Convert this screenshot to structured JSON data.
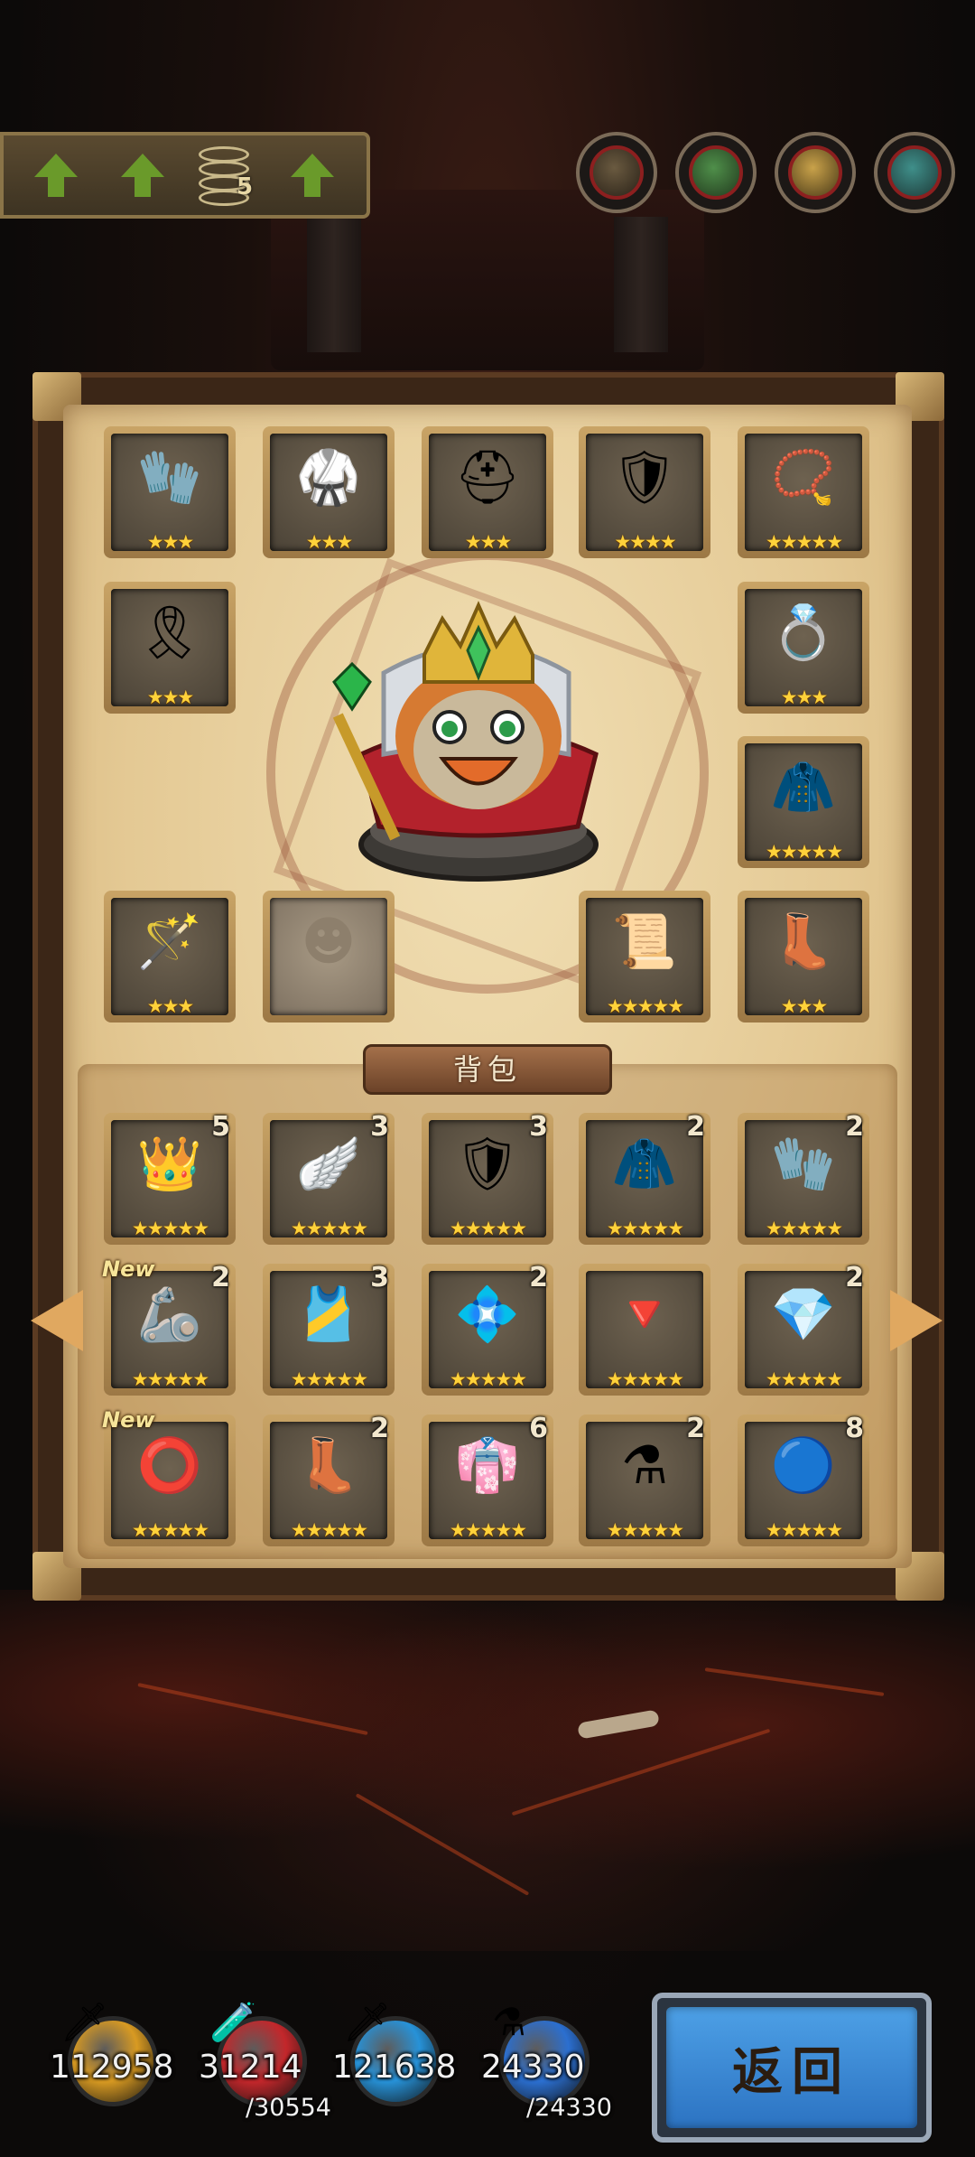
{
  "top_bar": {
    "stack_count": "5",
    "portraits": [
      "portrait-1",
      "portrait-2",
      "portrait-3",
      "portrait-4"
    ]
  },
  "equipped": {
    "row1": [
      {
        "icon": "gauntlet-icon",
        "glyph": "🧤",
        "stars": "★★★"
      },
      {
        "icon": "armor-icon",
        "glyph": "🥋",
        "stars": "★★★"
      },
      {
        "icon": "helmet-icon",
        "glyph": "⛑",
        "stars": "★★★"
      },
      {
        "icon": "chest-armor-icon",
        "glyph": "🛡",
        "stars": "★★★★"
      },
      {
        "icon": "bead-necklace-icon",
        "glyph": "📿",
        "stars": "★★★★★"
      }
    ],
    "left_mid": {
      "icon": "belt-icon",
      "glyph": "🎗",
      "stars": "★★★"
    },
    "right_mid1": {
      "icon": "ring-icon",
      "glyph": "💍",
      "stars": "★★★"
    },
    "right_mid2": {
      "icon": "cloak-icon",
      "glyph": "🧥",
      "stars": "★★★★★"
    },
    "row4": [
      {
        "icon": "scepter-icon",
        "glyph": "🪄",
        "stars": "★★★"
      },
      {
        "icon": "empty-slot-icon",
        "glyph": "",
        "stars": ""
      },
      {
        "icon": "scroll-icon",
        "glyph": "📜",
        "stars": "★★★★★"
      },
      {
        "icon": "boots-icon",
        "glyph": "👢",
        "stars": "★★★"
      }
    ]
  },
  "backpack": {
    "title": "背包",
    "items": [
      {
        "icon": "gold-helmet-icon",
        "glyph": "👑",
        "stars": "★★★★★",
        "count": "5",
        "new": ""
      },
      {
        "icon": "winged-bracer-icon",
        "glyph": "🪽",
        "stars": "★★★★★",
        "count": "3",
        "new": ""
      },
      {
        "icon": "gold-armor-icon",
        "glyph": "🛡",
        "stars": "★★★★★",
        "count": "3",
        "new": ""
      },
      {
        "icon": "blue-cloak-icon",
        "glyph": "🧥",
        "stars": "★★★★★",
        "count": "2",
        "new": ""
      },
      {
        "icon": "gold-gauntlet-icon",
        "glyph": "🧤",
        "stars": "★★★★★",
        "count": "2",
        "new": ""
      },
      {
        "icon": "bracer-icon",
        "glyph": "🦾",
        "stars": "★★★★★",
        "count": "2",
        "new": "New"
      },
      {
        "icon": "gold-chestplate-icon",
        "glyph": "🎽",
        "stars": "★★★★★",
        "count": "3",
        "new": ""
      },
      {
        "icon": "crown-belt-icon",
        "glyph": "💠",
        "stars": "★★★★★",
        "count": "2",
        "new": ""
      },
      {
        "icon": "amulet-icon",
        "glyph": "🔻",
        "stars": "★★★★★",
        "count": "",
        "new": ""
      },
      {
        "icon": "gem-necklace-icon",
        "glyph": "💎",
        "stars": "★★★★★",
        "count": "2",
        "new": ""
      },
      {
        "icon": "red-ring-icon",
        "glyph": "⭕",
        "stars": "★★★★★",
        "count": "",
        "new": "New"
      },
      {
        "icon": "purple-boots-icon",
        "glyph": "👢",
        "stars": "★★★★★",
        "count": "2",
        "new": ""
      },
      {
        "icon": "purple-robe-icon",
        "glyph": "👘",
        "stars": "★★★★★",
        "count": "6",
        "new": ""
      },
      {
        "icon": "potion-icon",
        "glyph": "⚗",
        "stars": "★★★★★",
        "count": "2",
        "new": ""
      },
      {
        "icon": "blue-orb-icon",
        "glyph": "🔵",
        "stars": "★★★★★",
        "count": "8",
        "new": ""
      }
    ]
  },
  "resources": [
    {
      "name": "gold",
      "value": "112958",
      "max": "",
      "color": "#d89a22",
      "icon": "sword-icon"
    },
    {
      "name": "hp",
      "value": "31214",
      "max": "/30554",
      "color": "#c3272b",
      "icon": "potion-icon"
    },
    {
      "name": "mana",
      "value": "121638",
      "max": "",
      "color": "#2792d8",
      "icon": "magic-sword-icon"
    },
    {
      "name": "energy",
      "value": "24330",
      "max": "/24330",
      "color": "#2b6fd0",
      "icon": "flask-icon"
    }
  ],
  "back_button": {
    "label": "返回"
  }
}
